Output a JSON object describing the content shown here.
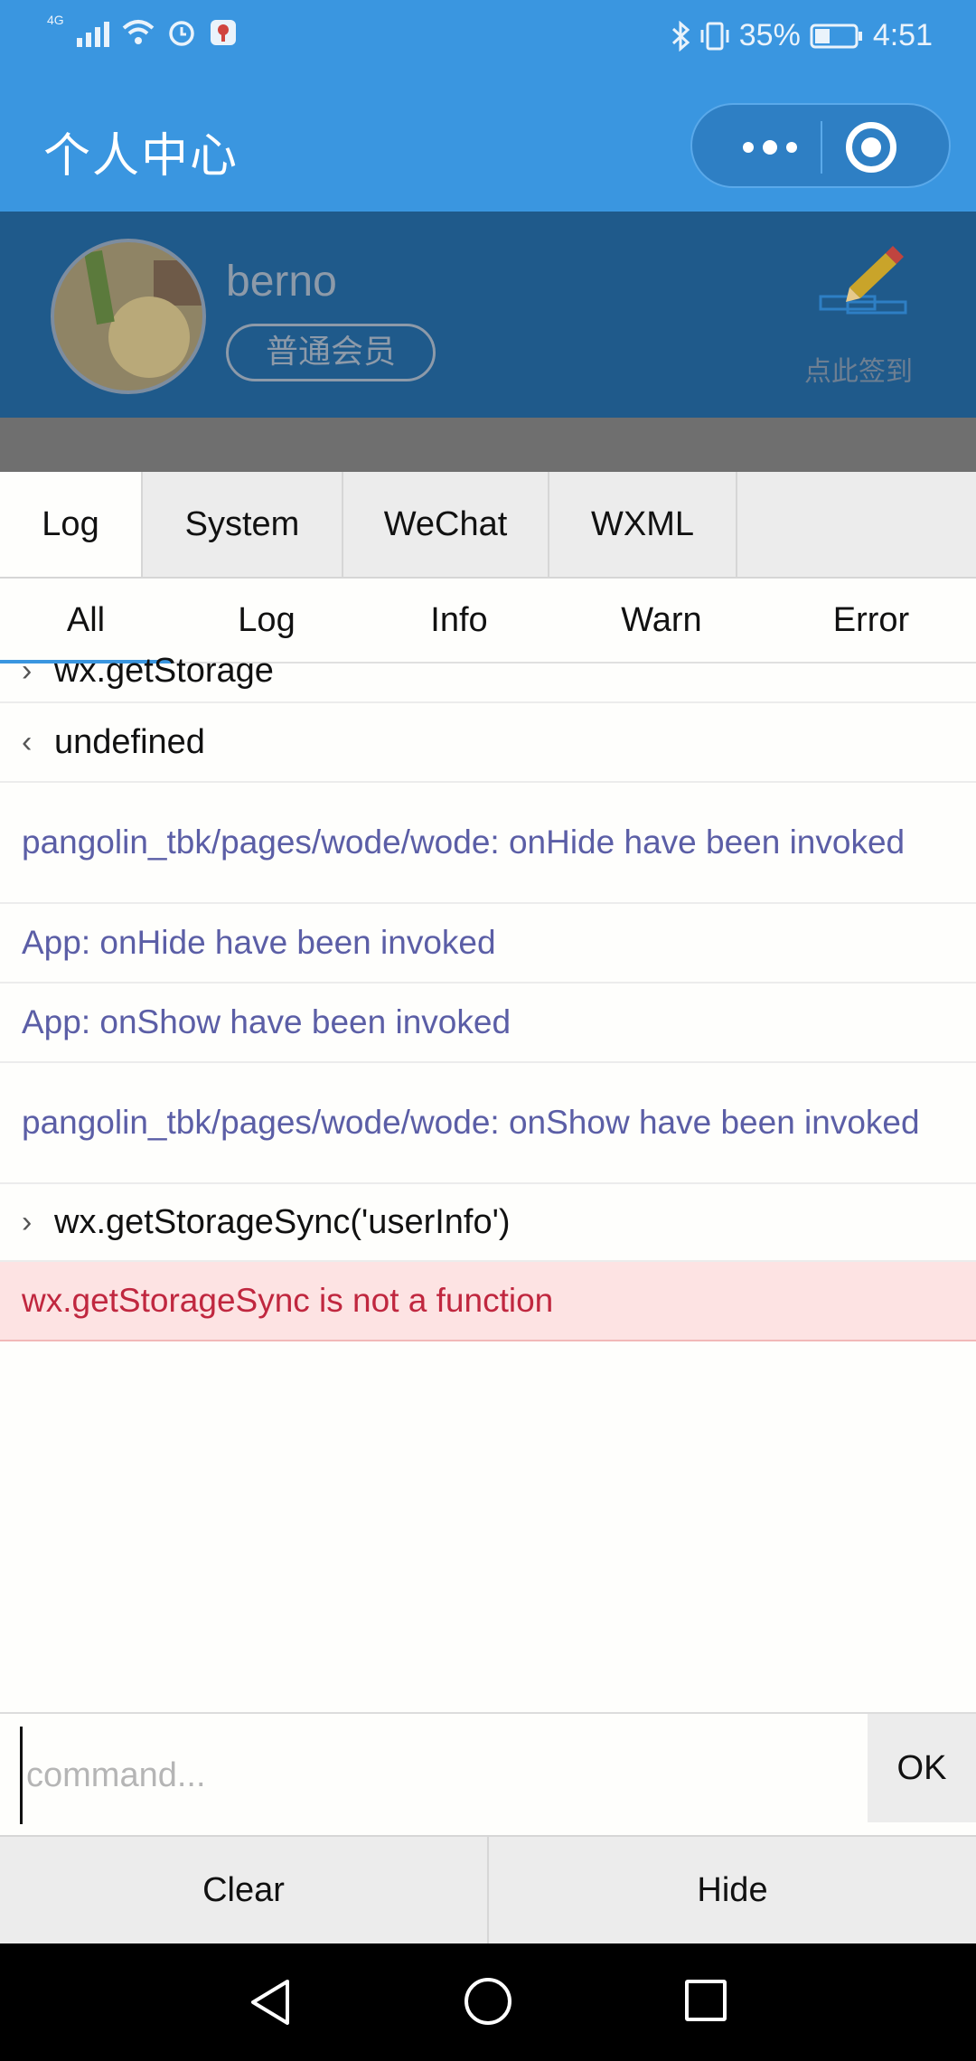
{
  "status_bar": {
    "network": "4G",
    "battery": "35%",
    "time": "4:51"
  },
  "header": {
    "title": "个人中心"
  },
  "profile": {
    "username": "berno",
    "member_level": "普通会员",
    "sign_in_label": "点此签到"
  },
  "console": {
    "tabs": [
      {
        "label": "Log"
      },
      {
        "label": "System"
      },
      {
        "label": "WeChat"
      },
      {
        "label": "WXML"
      }
    ],
    "filters": [
      {
        "label": "All"
      },
      {
        "label": "Log"
      },
      {
        "label": "Info"
      },
      {
        "label": "Warn"
      },
      {
        "label": "Error"
      }
    ],
    "logs": [
      {
        "type": "input",
        "arrow": "›",
        "text": "wx.getStorage"
      },
      {
        "type": "output",
        "arrow": "‹",
        "text": "undefined"
      },
      {
        "type": "info",
        "text": "pangolin_tbk/pages/wode/wode: onHide have been invoked"
      },
      {
        "type": "info",
        "text": "App: onHide have been invoked"
      },
      {
        "type": "info",
        "text": "App: onShow have been invoked"
      },
      {
        "type": "info",
        "text": "pangolin_tbk/pages/wode/wode: onShow have been invoked"
      },
      {
        "type": "input",
        "arrow": "›",
        "text": "wx.getStorageSync('userInfo')"
      },
      {
        "type": "error",
        "text": "wx.getStorageSync is not a function"
      }
    ],
    "command": {
      "placeholder": "command...",
      "value": "",
      "ok_label": "OK"
    },
    "buttons": {
      "clear_label": "Clear",
      "hide_label": "Hide"
    }
  },
  "colors": {
    "header_blue": "#3a96e0",
    "info_text": "#5b5ea6",
    "error_text": "#c0273f",
    "error_bg": "#fde3e3"
  }
}
